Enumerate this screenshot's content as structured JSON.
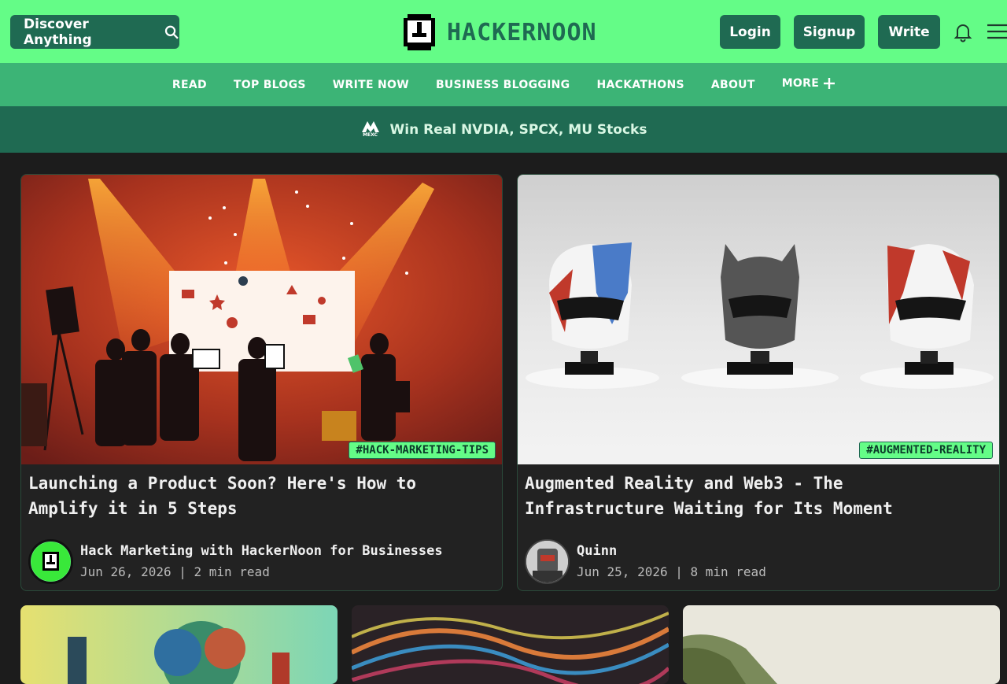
{
  "header": {
    "search_label": "Discover Anything",
    "logo_text": "HACKERNOON",
    "login": "Login",
    "signup": "Signup",
    "write": "Write"
  },
  "nav": {
    "items": [
      "READ",
      "TOP BLOGS",
      "WRITE NOW",
      "BUSINESS BLOGGING",
      "HACKATHONS",
      "ABOUT",
      "MORE"
    ]
  },
  "banner": {
    "brand": "MEXC",
    "text": "Win Real NVDIA, SPCX, MU Stocks"
  },
  "articles": [
    {
      "tag": "#HACK-MARKETING-TIPS",
      "title": "Launching a Product Soon? Here's How to Amplify it in 5 Steps",
      "author": "Hack Marketing with HackerNoon for Businesses",
      "meta": "Jun 26, 2026 | 2 min read"
    },
    {
      "tag": "#AUGMENTED-REALITY",
      "title": "Augmented Reality and Web3 - The Infrastructure Waiting for Its Moment",
      "author": "Quinn",
      "meta": "Jun 25, 2026 | 8 min read"
    }
  ],
  "colors": {
    "brand_green": "#64fc87",
    "dark_green": "#1f6a52",
    "nav_green": "#3cb476",
    "background": "#1c1c1c"
  }
}
